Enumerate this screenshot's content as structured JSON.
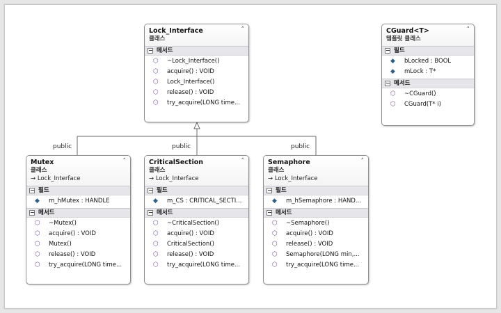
{
  "relations": [
    {
      "label": "public"
    },
    {
      "label": "public"
    },
    {
      "label": "public"
    }
  ],
  "classes": {
    "lock_interface": {
      "name": "Lock_Interface",
      "kind": "클래스",
      "methods_label": "메서드",
      "methods": [
        "~Lock_Interface()",
        "acquire() : VOID",
        "Lock_Interface()",
        "release() : VOID",
        "try_acquire(LONG  time..."
      ]
    },
    "cguard": {
      "name": "CGuard<T>",
      "kind": "템플릿 클래스",
      "fields_label": "필드",
      "fields": [
        "bLocked : BOOL",
        "mLock : T*"
      ],
      "methods_label": "메서드",
      "methods": [
        "~CGuard()",
        "CGuard(T* i)"
      ]
    },
    "mutex": {
      "name": "Mutex",
      "kind": "클래스",
      "base": "Lock_Interface",
      "fields_label": "필드",
      "fields": [
        "m_hMutex : HANDLE"
      ],
      "methods_label": "메서드",
      "methods": [
        "~Mutex()",
        "acquire() : VOID",
        "Mutex()",
        "release() : VOID",
        "try_acquire(LONG  time..."
      ]
    },
    "critical_section": {
      "name": "CriticalSection",
      "kind": "클래스",
      "base": "Lock_Interface",
      "fields_label": "필드",
      "fields": [
        "m_CS : CRITICAL_SECTI..."
      ],
      "methods_label": "메서드",
      "methods": [
        "~CriticalSection()",
        "acquire() : VOID",
        "CriticalSection()",
        "release() : VOID",
        "try_acquire(LONG  time..."
      ]
    },
    "semaphore": {
      "name": "Semaphore",
      "kind": "클래스",
      "base": "Lock_Interface",
      "fields_label": "필드",
      "fields": [
        "m_hSemaphore : HAND..."
      ],
      "methods_label": "메서드",
      "methods": [
        "~Semaphore()",
        "acquire() : VOID",
        "release() : VOID",
        "Semaphore(LONG  min,...",
        "try_acquire(LONG  time..."
      ]
    }
  },
  "icons": {
    "collapse": "double-chevron-up-icon",
    "inherits": "arrow-right-icon",
    "method": "method-cube-icon",
    "field": "field-icon",
    "section_toggle": "minus-box-icon"
  },
  "colors": {
    "section_bg": "#e6e6ea",
    "method_icon": "#7a52a8",
    "field_icon": "#2a5f8f",
    "border": "#8e8e8e"
  }
}
